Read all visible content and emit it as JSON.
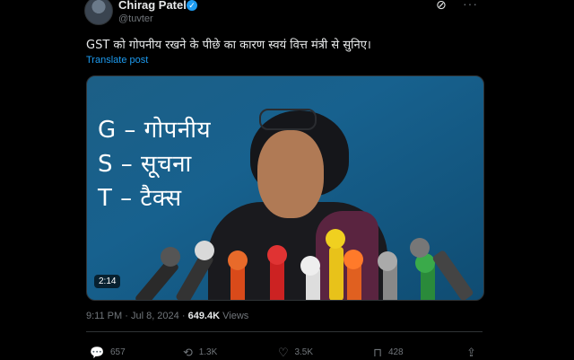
{
  "author": {
    "name": "Chirag Patel",
    "handle": "@tuvter",
    "verified_glyph": "✓"
  },
  "header_icons": {
    "grok": "⊘",
    "more": "···"
  },
  "tweet": {
    "text": "GST को गोपनीय रखने के पीछे का कारण स्वयं वित्त मंत्री से सुनिए।",
    "translate_label": "Translate post"
  },
  "media": {
    "overlay_lines": [
      "G – गोपनीय",
      "S – सूचना",
      "T – टैक्स"
    ],
    "duration": "2:14",
    "bg_color": "#17618e"
  },
  "meta": {
    "time": "9:11 PM",
    "separator": "·",
    "date": "Jul 8, 2024",
    "views_count": "649.4K",
    "views_label": "Views"
  },
  "actions": {
    "reply": {
      "icon": "reply-icon",
      "glyph": "💬",
      "count": "657"
    },
    "repost": {
      "icon": "repost-icon",
      "glyph": "⟲",
      "count": "1.3K"
    },
    "like": {
      "icon": "heart-icon",
      "glyph": "♡",
      "count": "3.5K"
    },
    "bookmark": {
      "icon": "bookmark-icon",
      "glyph": "⊓",
      "count": "428"
    },
    "share": {
      "icon": "share-icon",
      "glyph": "⇪"
    }
  }
}
